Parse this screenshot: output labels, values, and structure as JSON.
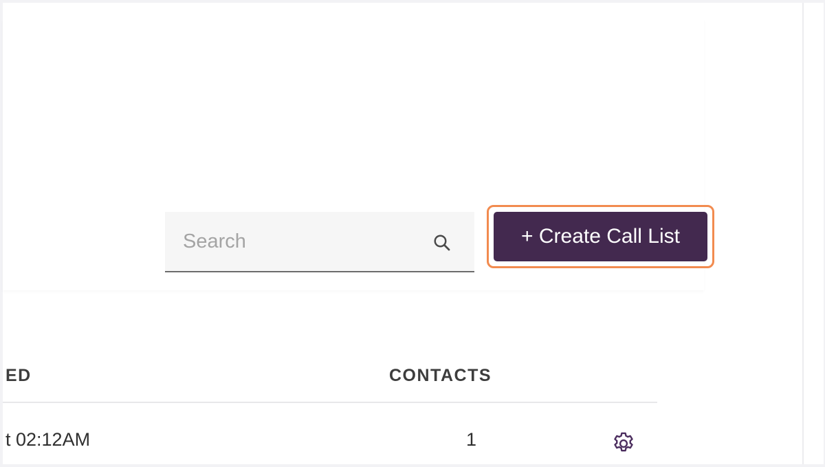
{
  "search": {
    "placeholder": "Search",
    "icon": "search-icon"
  },
  "toolbar": {
    "create_label": "+ Create Call List",
    "create_color": "#43294f",
    "highlight_color": "#f28b4f"
  },
  "table": {
    "columns": [
      "ED",
      "CONTACTS"
    ],
    "rows": [
      {
        "modified": "t 02:12AM",
        "contacts": "1",
        "action_icon": "gear-icon"
      }
    ]
  }
}
